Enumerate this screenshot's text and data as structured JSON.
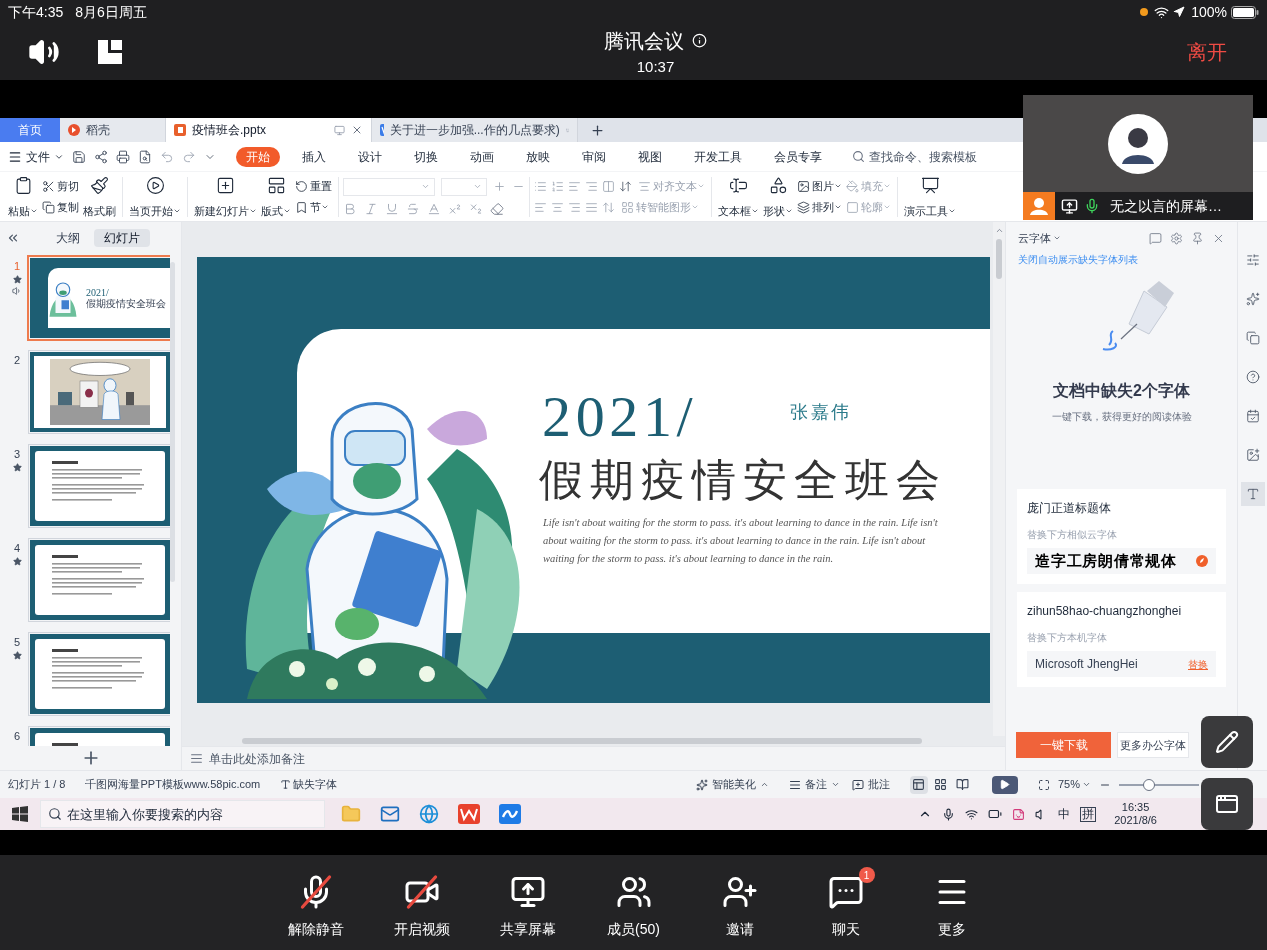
{
  "ios_status": {
    "time": "下午4:35",
    "date": "8月6日周五",
    "battery": "100%"
  },
  "meeting": {
    "title": "腾讯会议",
    "duration": "10:37",
    "leave": "离开"
  },
  "wps": {
    "tabs": [
      {
        "kind": "home",
        "label": "首页",
        "selected": false
      },
      {
        "kind": "app",
        "label": "稻壳",
        "selected": false
      },
      {
        "kind": "ppt",
        "label": "疫情班会.pptx",
        "selected": true
      },
      {
        "kind": "doc",
        "label": "关于进一步加强...作的几点要求)",
        "selected": false
      }
    ],
    "file_menu": "文件",
    "ribbon_tabs": [
      {
        "label": "开始",
        "selected": true
      },
      {
        "label": "插入",
        "selected": false
      },
      {
        "label": "设计",
        "selected": false
      },
      {
        "label": "切换",
        "selected": false
      },
      {
        "label": "动画",
        "selected": false
      },
      {
        "label": "放映",
        "selected": false
      },
      {
        "label": "审阅",
        "selected": false
      },
      {
        "label": "视图",
        "selected": false
      },
      {
        "label": "开发工具",
        "selected": false
      },
      {
        "label": "会员专享",
        "selected": false
      }
    ],
    "command_search": {
      "placeholder": "查找命令、搜索模板"
    },
    "ribbon": {
      "paste": {
        "label": "粘贴",
        "dropdown": true,
        "disabled": false
      },
      "cut": {
        "label": "剪切",
        "dropdown": false,
        "disabled": false
      },
      "copy": {
        "label": "复制",
        "dropdown": false,
        "disabled": false
      },
      "format_painter": {
        "label": "格式刷",
        "dropdown": false,
        "disabled": false
      },
      "play_from_current": {
        "label": "当页开始",
        "dropdown": true,
        "disabled": false
      },
      "new_slide": {
        "label": "新建幻灯片",
        "dropdown": true,
        "disabled": false
      },
      "layout": {
        "label": "版式",
        "dropdown": true,
        "disabled": false
      },
      "reset": {
        "label": "重置",
        "dropdown": false,
        "disabled": false
      },
      "section": {
        "label": "节",
        "dropdown": true,
        "disabled": false
      },
      "align_text": {
        "label": "对齐文本",
        "dropdown": true,
        "disabled": true
      },
      "smartart": {
        "label": "转智能图形",
        "dropdown": true,
        "disabled": true
      },
      "text_box": {
        "label": "文本框",
        "dropdown": true,
        "disabled": false
      },
      "shape": {
        "label": "形状",
        "dropdown": true,
        "disabled": false
      },
      "picture": {
        "label": "图片",
        "dropdown": true,
        "disabled": false
      },
      "arrange": {
        "label": "排列",
        "dropdown": true,
        "disabled": false
      },
      "fill": {
        "label": "填充",
        "dropdown": true,
        "disabled": true
      },
      "outline": {
        "label": "轮廓",
        "dropdown": true,
        "disabled": true
      },
      "presenter_tools": {
        "label": "演示工具",
        "dropdown": true,
        "disabled": false
      }
    },
    "side_tabs": [
      {
        "label": "大纲",
        "selected": false
      },
      {
        "label": "幻灯片",
        "selected": true
      }
    ],
    "slides": [
      {
        "number": "1",
        "kind": "title",
        "selected": true,
        "animated": true,
        "audio": true,
        "year": "2021/",
        "title": "假期疫情安全班会"
      },
      {
        "number": "2",
        "kind": "picture",
        "selected": false,
        "animated": false,
        "audio": false
      },
      {
        "number": "3",
        "kind": "text",
        "selected": false,
        "animated": true,
        "audio": false
      },
      {
        "number": "4",
        "kind": "text",
        "selected": false,
        "animated": true,
        "audio": false
      },
      {
        "number": "5",
        "kind": "text",
        "selected": false,
        "animated": true,
        "audio": false
      },
      {
        "number": "6",
        "kind": "text",
        "selected": false,
        "animated": false,
        "audio": false
      }
    ],
    "slide": {
      "year": "2021/",
      "author": "张嘉伟",
      "title": "假期疫情安全班会",
      "body": "Life isn't about waiting for the storm to pass. it's about learning to dance in the rain.  Life isn't about waiting for the storm to pass. it's about learning to dance in the rain.  Life isn't about waiting for the storm to pass. it's about learning to dance in the rain."
    },
    "notes_placeholder": "单击此处添加备注",
    "font_panel": {
      "title": "云字体",
      "link": "关闭自动展示缺失字体列表",
      "heading": "文档中缺失2个字体",
      "subheading": "一键下载，获得更好的阅读体验",
      "fonts": [
        {
          "kind": "cloud",
          "name": "庞门正道标题体",
          "hint": "替换下方相似云字体",
          "replacement": "造字工房朗倩常规体"
        },
        {
          "kind": "local",
          "name": "zihun58hao-chuangzhonghei",
          "hint": "替换下方本机字体",
          "replacement": "Microsoft JhengHei",
          "action": "替换"
        }
      ],
      "download": "一键下载",
      "more_fonts": "更多办公字体"
    },
    "side_tools": [
      {
        "selected": false
      },
      {
        "selected": false
      },
      {
        "selected": false
      },
      {
        "selected": false
      },
      {
        "selected": false
      },
      {
        "selected": false
      },
      {
        "selected": true
      }
    ],
    "status": {
      "slide_count": "幻灯片 1 / 8",
      "template": "千图网海量PPT模板www.58pic.com",
      "missing_fonts": "缺失字体",
      "beautify": "智能美化",
      "notes": "备注",
      "comments": "批注",
      "views": [
        {
          "selected": true
        },
        {
          "selected": false
        },
        {
          "selected": false
        }
      ],
      "zoom": "75%",
      "zoom_slider": {
        "level": 0.38
      }
    },
    "taskbar": {
      "search_placeholder": "在这里输入你要搜索的内容",
      "ime_mode": "中",
      "ime": "拼",
      "time": "16:35",
      "date": "2021/8/6"
    }
  },
  "video_tile": {
    "name": "无之以言的屏幕…"
  },
  "toolbar": [
    {
      "kind": "mic",
      "label": "解除静音",
      "off": true
    },
    {
      "kind": "video",
      "label": "开启视频",
      "off": true
    },
    {
      "kind": "share",
      "label": "共享屏幕",
      "off": false
    },
    {
      "kind": "members",
      "label": "成员(50)",
      "off": false
    },
    {
      "kind": "invite",
      "label": "邀请",
      "off": false
    },
    {
      "kind": "chat",
      "label": "聊天",
      "off": false,
      "badge": "1"
    },
    {
      "kind": "more",
      "label": "更多",
      "off": false
    }
  ]
}
